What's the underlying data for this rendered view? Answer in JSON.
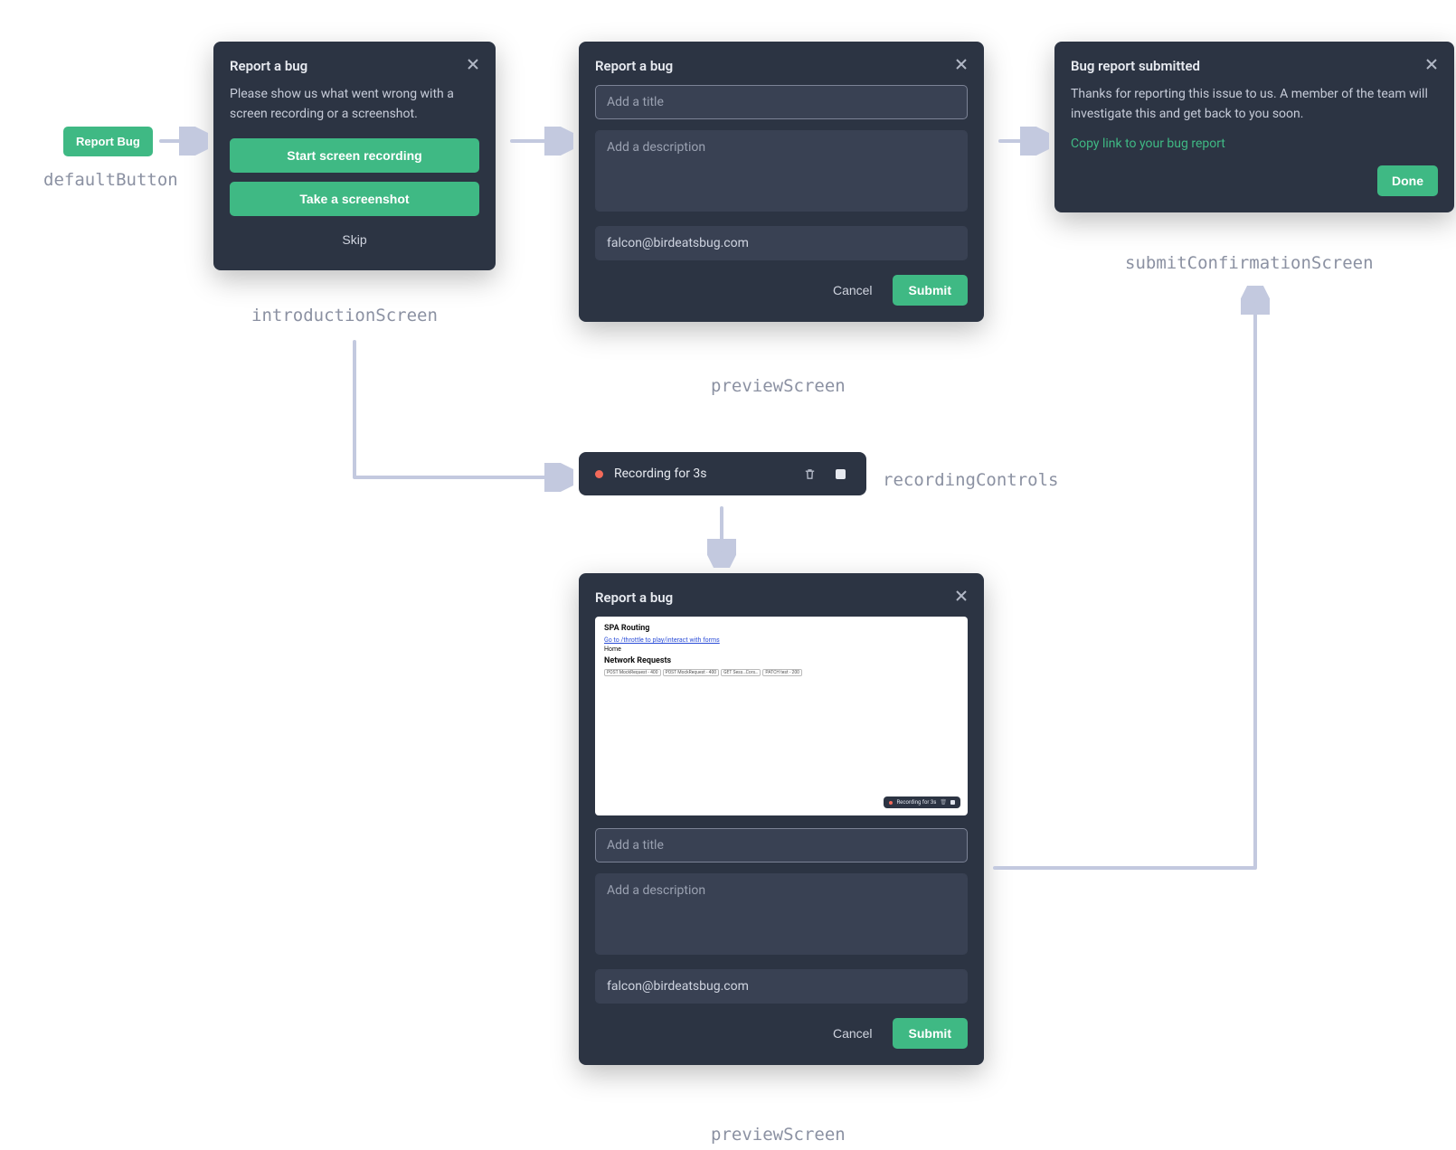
{
  "labels": {
    "defaultButton": "defaultButton",
    "introductionScreen": "introductionScreen",
    "previewScreenTop": "previewScreen",
    "previewScreenBottom": "previewScreen",
    "recordingControls": "recordingControls",
    "submitConfirmationScreen": "submitConfirmationScreen"
  },
  "defaultButton": {
    "label": "Report Bug"
  },
  "introduction": {
    "title": "Report a bug",
    "body": "Please show us what went wrong with a screen recording or a screenshot.",
    "startRecording": "Start screen recording",
    "takeScreenshot": "Take a screenshot",
    "skip": "Skip"
  },
  "previewTop": {
    "title": "Report a bug",
    "titlePlaceholder": "Add a title",
    "descPlaceholder": "Add a description",
    "email": "falcon@birdeatsbug.com",
    "cancel": "Cancel",
    "submit": "Submit"
  },
  "recording": {
    "text": "Recording for 3s"
  },
  "previewBottom": {
    "title": "Report a bug",
    "titlePlaceholder": "Add a title",
    "descPlaceholder": "Add a description",
    "email": "falcon@birdeatsbug.com",
    "cancel": "Cancel",
    "submit": "Submit",
    "screenshot": {
      "h1a": "SPA Routing",
      "link": "Go to /throttle to play/interact with forms",
      "home": "Home",
      "h1b": "Network Requests",
      "chips": [
        "POST MockRequest - 400",
        "POST MockRequest - 400",
        "GET Sess…Cors…",
        "PATCH test - 200"
      ],
      "miniText": "Recording for 3s"
    }
  },
  "confirmation": {
    "title": "Bug report submitted",
    "body": "Thanks for reporting this issue to us. A member of the team will investigate this and get back to you soon.",
    "link": "Copy link to your bug report",
    "done": "Done"
  }
}
